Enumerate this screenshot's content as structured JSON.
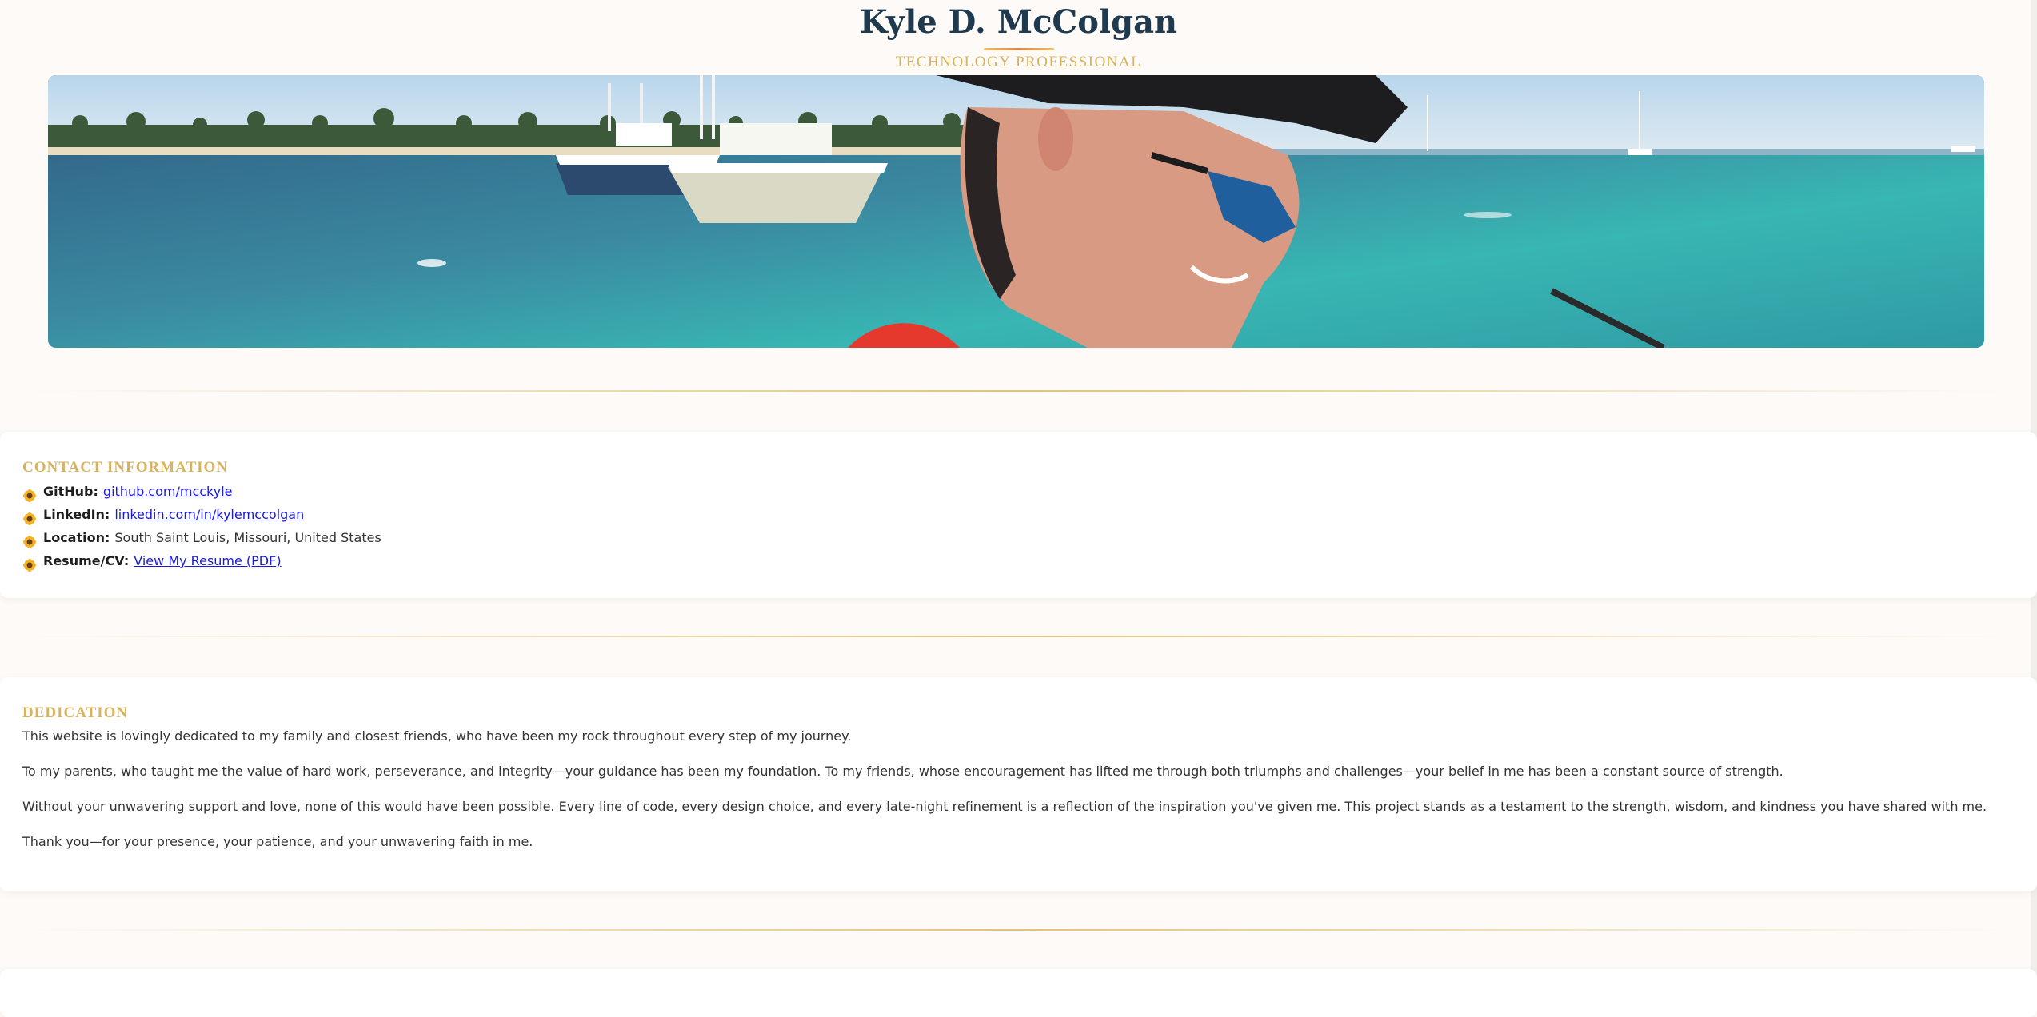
{
  "header": {
    "name": "Kyle D. McColgan",
    "tagline": "TECHNOLOGY PROFESSIONAL"
  },
  "banner": {
    "icon": "banner-photo"
  },
  "contact": {
    "title": "CONTACT INFORMATION",
    "items": [
      {
        "label": "GitHub:",
        "value": "github.com/mcckyle",
        "is_link": true
      },
      {
        "label": "LinkedIn:",
        "value": "linkedin.com/in/kylemccolgan",
        "is_link": true
      },
      {
        "label": "Location:",
        "value": "South Saint Louis, Missouri, United States",
        "is_link": false
      },
      {
        "label": "Resume/CV:",
        "value": "View My Resume (PDF)",
        "is_link": true
      }
    ],
    "bullet_icon": "sunflower-icon"
  },
  "dedication": {
    "title": "DEDICATION",
    "paragraphs": [
      "This website is lovingly dedicated to my family and closest friends, who have been my rock throughout every step of my journey.",
      "To my parents, who taught me the value of hard work, perseverance, and integrity—your guidance has been my foundation. To my friends, whose encouragement has lifted me through both triumphs and challenges—your belief in me has been a constant source of strength.",
      "Without your unwavering support and love, none of this would have been possible. Every line of code, every design choice, and every late-night refinement is a reflection of the inspiration you've given me. This project stands as a testament to the strength, wisdom, and kindness you have shared with me.",
      "Thank you—for your presence, your patience, and your unwavering faith in me."
    ]
  },
  "colors": {
    "name": "#1f3a4e",
    "accent_gold": "#d8b25c",
    "link": "#1a1adb",
    "background": "#fdfaf7"
  }
}
